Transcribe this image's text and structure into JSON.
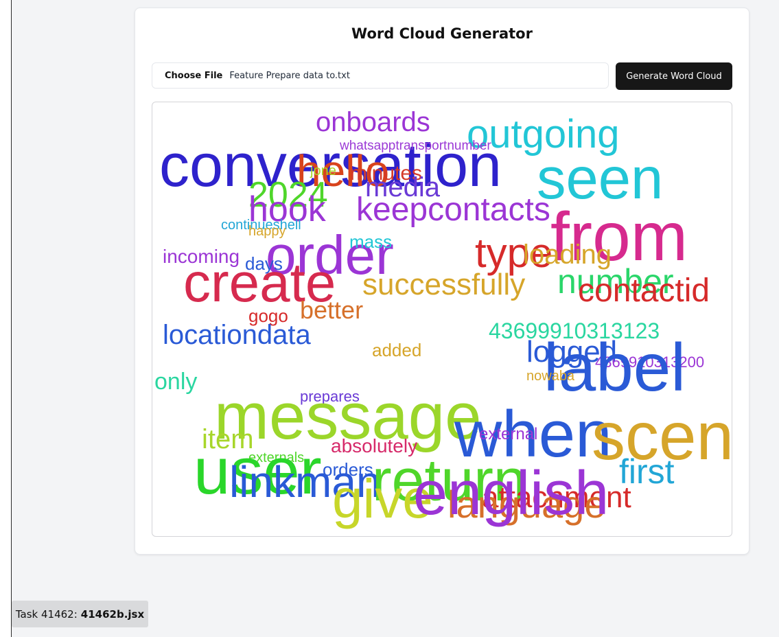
{
  "app": {
    "title": "Word Cloud Generator"
  },
  "file_input": {
    "button_label": "Choose File",
    "file_name": "Feature Prepare data to.txt"
  },
  "generate_button": {
    "label": "Generate Word Cloud"
  },
  "word_cloud": {
    "words": [
      {
        "text": "conversation",
        "color": "#2e22cc"
      },
      {
        "text": "onboards",
        "color": "#9b35d5"
      },
      {
        "text": "outgoing",
        "color": "#22c6d6"
      },
      {
        "text": "whatsapptransportnumber",
        "color": "#9b3ad6"
      },
      {
        "text": "hello",
        "color": "#d8431c"
      },
      {
        "text": "seen",
        "color": "#22c6d6"
      },
      {
        "text": "jone",
        "color": "#a7d62a"
      },
      {
        "text": "minutes",
        "color": "#d43a2a"
      },
      {
        "text": "media",
        "color": "#6a3ad6"
      },
      {
        "text": "2024",
        "color": "#4fd62a"
      },
      {
        "text": "hook",
        "color": "#9b35d5"
      },
      {
        "text": "keepcontacts",
        "color": "#9b35d5"
      },
      {
        "text": "from",
        "color": "#d62a8e"
      },
      {
        "text": "continueshell",
        "color": "#22a6d6"
      },
      {
        "text": "happy",
        "color": "#d6a52a"
      },
      {
        "text": "order",
        "color": "#9b35d5"
      },
      {
        "text": "type",
        "color": "#d62a2a"
      },
      {
        "text": "mass",
        "color": "#22c6d6"
      },
      {
        "text": "incoming",
        "color": "#9b35d5"
      },
      {
        "text": "days",
        "color": "#2a5ad6"
      },
      {
        "text": "loading",
        "color": "#d6a52a"
      },
      {
        "text": "create",
        "color": "#d62a4e"
      },
      {
        "text": "successfully",
        "color": "#d6a52a"
      },
      {
        "text": "number",
        "color": "#2ad66a"
      },
      {
        "text": "contactid",
        "color": "#d62a2a"
      },
      {
        "text": "gogo",
        "color": "#d62a2a"
      },
      {
        "text": "better",
        "color": "#d6702a"
      },
      {
        "text": "locationdata",
        "color": "#2a5ad6"
      },
      {
        "text": "43699910313123",
        "color": "#2ad6a0"
      },
      {
        "text": "logged",
        "color": "#2a5ad6"
      },
      {
        "text": "4369910313200",
        "color": "#9b35d5"
      },
      {
        "text": "added",
        "color": "#d6a52a"
      },
      {
        "text": "label",
        "color": "#2a5ad6"
      },
      {
        "text": "nowaba",
        "color": "#d6a52a"
      },
      {
        "text": "only",
        "color": "#2ad6a0"
      },
      {
        "text": "prepares",
        "color": "#6a3ad6"
      },
      {
        "text": "message",
        "color": "#9bd62a"
      },
      {
        "text": "when",
        "color": "#2a5ad6"
      },
      {
        "text": "scenario",
        "color": "#d6a52a"
      },
      {
        "text": "item",
        "color": "#a7d62a"
      },
      {
        "text": "absolutely",
        "color": "#d62a6a"
      },
      {
        "text": "externals",
        "color": "#4fd62a"
      },
      {
        "text": "external",
        "color": "#9b35d5"
      },
      {
        "text": "user",
        "color": "#2ad62a"
      },
      {
        "text": "linkman",
        "color": "#2a5ad6"
      },
      {
        "text": "orders",
        "color": "#2a5ad6"
      },
      {
        "text": "return",
        "color": "#4fd62a"
      },
      {
        "text": "first",
        "color": "#22a6d6"
      },
      {
        "text": "attachment",
        "color": "#d62a2a"
      },
      {
        "text": "language",
        "color": "#d6702a"
      },
      {
        "text": "give",
        "color": "#c7d62a"
      },
      {
        "text": "english",
        "color": "#9b35d5"
      }
    ]
  },
  "task_badge": {
    "prefix": "Task 41462:",
    "file": "41462b.jsx"
  }
}
